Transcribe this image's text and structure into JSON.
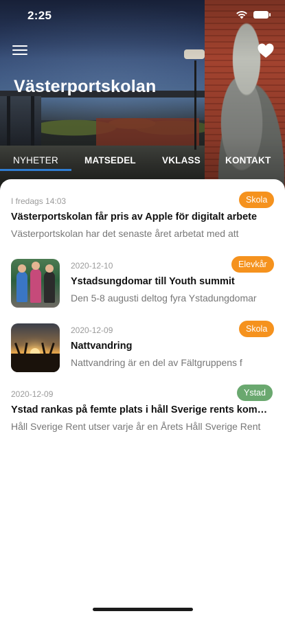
{
  "status_bar": {
    "time": "2:25",
    "wifi_icon": "wifi-icon",
    "battery_icon": "battery-icon"
  },
  "header": {
    "title": "Västerportskolan",
    "menu_icon": "hamburger-menu-icon",
    "favorite_icon": "heart-icon"
  },
  "tabs": [
    {
      "label": "NYHETER",
      "active": true
    },
    {
      "label": "MATSEDEL",
      "active": false
    },
    {
      "label": "VKLASS",
      "active": false
    },
    {
      "label": "KONTAKT",
      "active": false
    }
  ],
  "colors": {
    "accent_blue": "#2f7dd1",
    "badge_orange": "#f5921e",
    "badge_green": "#6aa86f"
  },
  "news": [
    {
      "date": "I fredags 14:03",
      "title": "Västerportskolan får pris av Apple för digitalt arbete",
      "desc": "Västerportskolan har det senaste året arbetat med att",
      "badge": "Skola",
      "badge_color": "#f5921e",
      "has_image": false
    },
    {
      "date": "2020-12-10",
      "title": "Ystadsungdomar till Youth summit",
      "desc": "Den 5-8 augusti deltog fyra Ystadungdomar",
      "badge": "Elevkår",
      "badge_color": "#f5921e",
      "has_image": true
    },
    {
      "date": "2020-12-09",
      "title": "Nattvandring",
      "desc": "Nattvandring är en del av Fältgruppens f",
      "badge": "Skola",
      "badge_color": "#f5921e",
      "has_image": true
    },
    {
      "date": "2020-12-09",
      "title": "Ystad rankas på femte plats i håll Sverige rents kommuner",
      "desc": "Håll Sverige Rent utser varje år en Årets Håll Sverige Rent",
      "badge": "Ystad",
      "badge_color": "#6aa86f",
      "has_image": false
    }
  ]
}
